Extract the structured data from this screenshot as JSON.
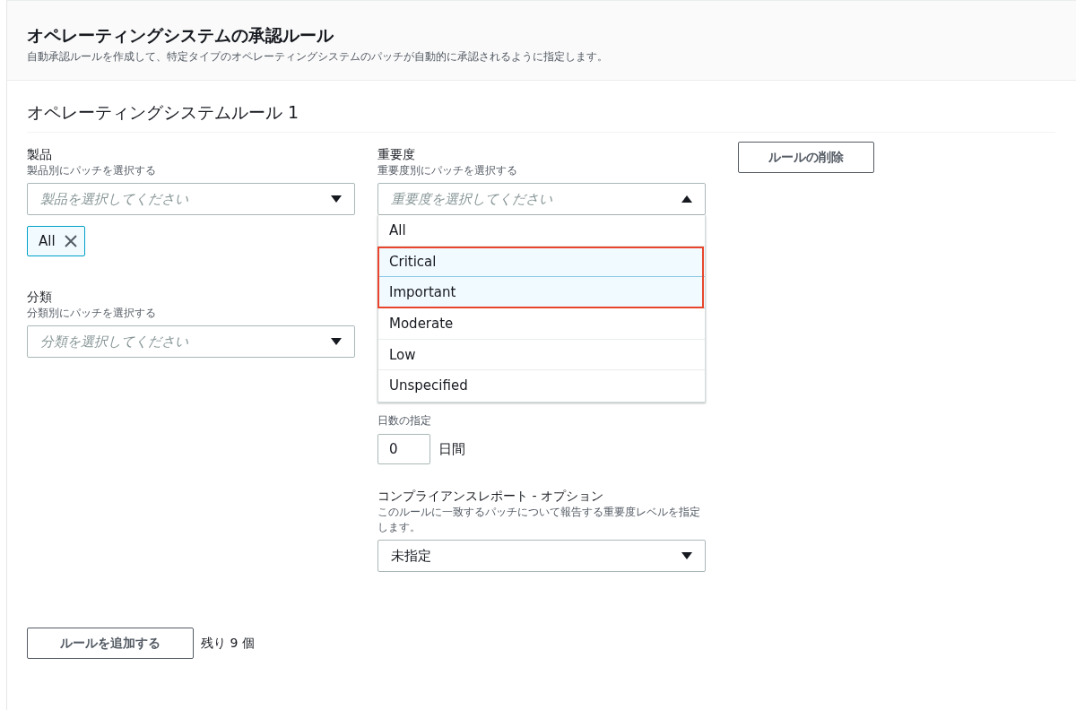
{
  "header": {
    "title": "オペレーティングシステムの承認ルール",
    "description": "自動承認ルールを作成して、特定タイプのオペレーティングシステムのパッチが自動的に承認されるように指定します。"
  },
  "rule": {
    "title": "オペレーティングシステムルール 1",
    "delete_button": "ルールの削除",
    "product": {
      "label": "製品",
      "description": "製品別にパッチを選択する",
      "placeholder": "製品を選択してください",
      "expanded": false,
      "tokens": [
        {
          "label": "All"
        }
      ]
    },
    "classification": {
      "label": "分類",
      "description": "分類別にパッチを選択する",
      "placeholder": "分類を選択してください",
      "expanded": false
    },
    "severity": {
      "label": "重要度",
      "description": "重要度別にパッチを選択する",
      "placeholder": "重要度を選択してください",
      "expanded": true,
      "highlight_selected": true,
      "options": [
        {
          "label": "All",
          "selected": false
        },
        {
          "label": "Critical",
          "selected": true
        },
        {
          "label": "Important",
          "selected": true
        },
        {
          "label": "Moderate",
          "selected": false
        },
        {
          "label": "Low",
          "selected": false
        },
        {
          "label": "Unspecified",
          "selected": false
        }
      ]
    },
    "days": {
      "label": "日数の指定",
      "value": "0",
      "unit": "日間"
    },
    "compliance": {
      "label": "コンプライアンスレポート - オプション",
      "description": "このルールに一致するパッチについて報告する重要度レベルを指定します。",
      "value": "未指定",
      "expanded": false
    }
  },
  "footer": {
    "add_button": "ルールを追加する",
    "remaining": "残り 9 個"
  }
}
